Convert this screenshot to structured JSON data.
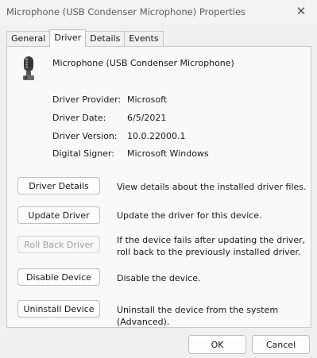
{
  "window": {
    "title": "Microphone (USB Condenser Microphone) Properties"
  },
  "tabs": [
    {
      "label": "General"
    },
    {
      "label": "Driver"
    },
    {
      "label": "Details"
    },
    {
      "label": "Events"
    }
  ],
  "active_tab": "Driver",
  "device": {
    "icon": "microphone-icon",
    "name": "Microphone (USB Condenser Microphone)"
  },
  "properties": [
    {
      "label": "Driver Provider:",
      "value": "Microsoft"
    },
    {
      "label": "Driver Date:",
      "value": "6/5/2021"
    },
    {
      "label": "Driver Version:",
      "value": "10.0.22000.1"
    },
    {
      "label": "Digital Signer:",
      "value": "Microsoft Windows"
    }
  ],
  "actions": [
    {
      "label": "Driver Details",
      "description": "View details about the installed driver files.",
      "enabled": true
    },
    {
      "label": "Update Driver",
      "description": "Update the driver for this device.",
      "enabled": true
    },
    {
      "label": "Roll Back Driver",
      "description": "If the device fails after updating the driver, roll back to the previously installed driver.",
      "enabled": false
    },
    {
      "label": "Disable Device",
      "description": "Disable the device.",
      "enabled": true
    },
    {
      "label": "Uninstall Device",
      "description": "Uninstall the device from the system (Advanced).",
      "enabled": true
    }
  ],
  "footer": {
    "ok_label": "OK",
    "cancel_label": "Cancel"
  },
  "icons": {
    "close": "close-icon"
  }
}
